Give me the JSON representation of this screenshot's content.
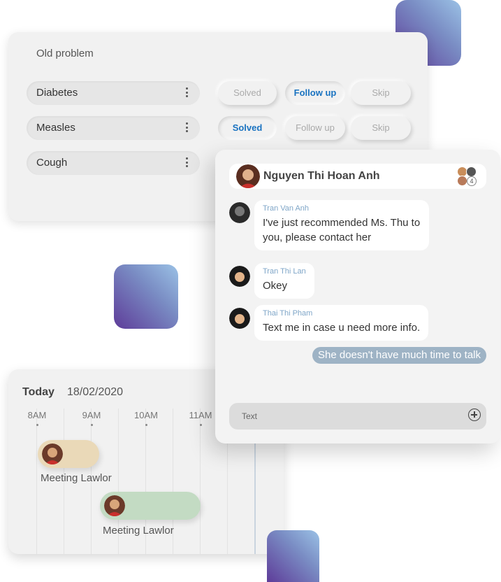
{
  "problems": {
    "title": "Old problem",
    "rows": [
      {
        "name": "Diabetes",
        "active": "follow_up"
      },
      {
        "name": "Measles",
        "active": "solved"
      },
      {
        "name": "Cough",
        "active": ""
      }
    ],
    "actions": {
      "solved": "Solved",
      "follow_up": "Follow up",
      "skip": "Skip"
    }
  },
  "chat": {
    "header_name": "Nguyen Thi Hoan Anh",
    "member_count": "4",
    "messages": [
      {
        "sender": "Tran Van Anh",
        "text": "I've just recommended Ms. Thu to you, please  contact her"
      },
      {
        "sender": "Tran Thi Lan",
        "text": "Okey"
      },
      {
        "sender": "Thai Thi Pham",
        "text": "Text me in case u need more info."
      }
    ],
    "own_message": "She  doesn't have much time to talk",
    "input_placeholder": "Text"
  },
  "schedule": {
    "today_label": "Today",
    "date": "18/02/2020",
    "times": [
      "8AM",
      "9AM",
      "10AM",
      "11AM"
    ],
    "events": [
      {
        "label": "Meeting Lawlor",
        "color": "#ead9b8"
      },
      {
        "label": "Meeting Lawlor",
        "color": "#c3dbc3"
      }
    ]
  },
  "colors": {
    "accent": "#1a73c1",
    "sender": "#7fa6c8",
    "own_bubble": "#9eb3c5",
    "gradient_start": "#5e3c99",
    "gradient_end": "#9bc2e6"
  },
  "icons": [
    "kebab-icon",
    "add-circle-icon",
    "avatar"
  ]
}
